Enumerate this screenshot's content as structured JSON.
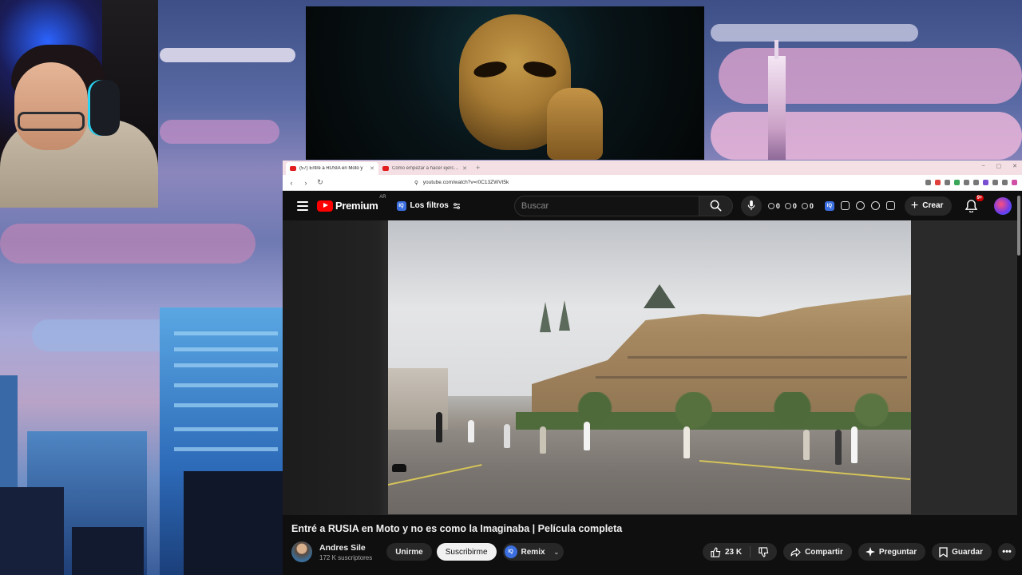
{
  "browser": {
    "tabs": [
      {
        "label": "(57) Entré a RUSIA en Moto y",
        "active": true
      },
      {
        "label": "Cómo empezar a hacer ejercicio",
        "active": false
      }
    ],
    "url": "youtube.com/watch?v=r0C13ZWVt5k",
    "window_controls": [
      "–",
      "▢",
      "✕"
    ]
  },
  "youtube": {
    "logo_text": "Premium",
    "region": "AR",
    "filters_label": "Los filtros",
    "filters_badge": "IQ",
    "search_placeholder": "Buscar",
    "stats": [
      "0",
      "0",
      "0"
    ],
    "create_label": "Crear",
    "notifications_badge": "9+"
  },
  "video": {
    "title": "Entré a RUSIA en Moto y no es como la Imaginaba | Película completa",
    "channel_name": "Andres Sile",
    "subscribers": "172 K suscriptores",
    "join_label": "Unirme",
    "subscribe_label": "Suscribirme",
    "remix_label": "Remix",
    "remix_badge": "IQ",
    "likes": "23 K",
    "share_label": "Compartir",
    "ask_label": "Preguntar",
    "save_label": "Guardar"
  },
  "colors": {
    "yt_red": "#ff0000",
    "yt_bg": "#0f0f0f",
    "badge_blue": "#3b6fe0"
  }
}
